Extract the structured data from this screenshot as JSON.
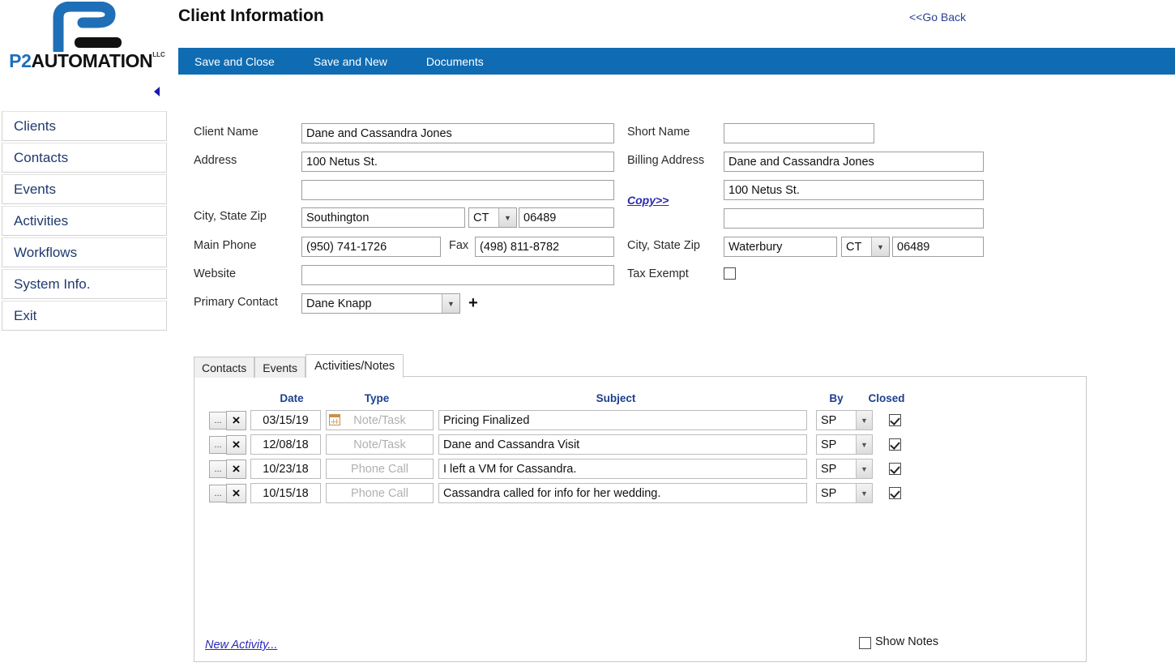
{
  "brand": {
    "logo_p2": "P2",
    "logo_automation": "AUTOMATION",
    "logo_tm": "LLC",
    "logo_icon": "p2-logo-mark",
    "collapse_icon": "collapse-left-arrow-icon"
  },
  "header": {
    "title": "Client Information",
    "go_back": "<<Go Back"
  },
  "toolbar": {
    "items": [
      {
        "label": "Save and Close",
        "name": "save-and-close"
      },
      {
        "label": "Save and New",
        "name": "save-and-new"
      },
      {
        "label": "Documents",
        "name": "documents"
      }
    ]
  },
  "sidebar": {
    "items": [
      {
        "label": "Clients"
      },
      {
        "label": "Contacts"
      },
      {
        "label": "Events"
      },
      {
        "label": "Activities"
      },
      {
        "label": "Workflows"
      },
      {
        "label": "System Info."
      },
      {
        "label": "Exit"
      }
    ]
  },
  "form": {
    "left": {
      "client_name_label": "Client Name",
      "client_name_value": "Dane and Cassandra Jones",
      "address_label": "Address",
      "address_line1": "100 Netus St.",
      "address_line2": "",
      "city_state_zip_label": "City, State Zip",
      "city": "Southington",
      "state": "CT",
      "zip": "06489",
      "main_phone_label": "Main Phone",
      "main_phone": "(950) 741-1726",
      "fax_label": "Fax",
      "fax": "(498) 811-8782",
      "website_label": "Website",
      "website": "",
      "primary_contact_label": "Primary Contact",
      "primary_contact": "Dane Knapp",
      "add_contact_icon": "plus-icon"
    },
    "right": {
      "short_name_label": "Short Name",
      "short_name_value": "",
      "billing_address_label": "Billing Address",
      "billing_line1": "Dane and Cassandra Jones",
      "billing_line2": "100 Netus St.",
      "billing_line3": "",
      "copy_link": "Copy>>",
      "city_state_zip_label": "City, State Zip",
      "city": "Waterbury",
      "state": "CT",
      "zip": "06489",
      "tax_exempt_label": "Tax Exempt",
      "tax_exempt_checked": false
    }
  },
  "tabs": [
    {
      "label": "Contacts",
      "active": false
    },
    {
      "label": "Events",
      "active": false
    },
    {
      "label": "Activities/Notes",
      "active": true
    }
  ],
  "grid": {
    "columns": [
      "Date",
      "Type",
      "Subject",
      "By",
      "Closed"
    ],
    "row_menu_label": "...",
    "row_delete_label": "×",
    "rows": [
      {
        "date": "03/15/19",
        "type": "Note/Task",
        "type_icon": "calendar-grid-icon",
        "subject": "Pricing Finalized",
        "by": "SP",
        "closed": true
      },
      {
        "date": "12/08/18",
        "type": "Note/Task",
        "type_icon": "",
        "subject": "Dane and Cassandra Visit",
        "by": "SP",
        "closed": true
      },
      {
        "date": "10/23/18",
        "type": "Phone Call",
        "type_icon": "",
        "subject": "I left a VM for Cassandra.",
        "by": "SP",
        "closed": true
      },
      {
        "date": "10/15/18",
        "type": "Phone Call",
        "type_icon": "",
        "subject": "Cassandra called for info for her wedding.",
        "by": "SP",
        "closed": true
      }
    ],
    "new_activity": "New Activity...",
    "show_notes_label": "Show Notes",
    "show_notes_checked": false
  },
  "colors": {
    "toolbar_blue": "#0f6cb3",
    "brand_blue": "#1f6fb8",
    "link_blue": "#2a2ab5",
    "sidebar_text": "#1f3a6e",
    "grid_header": "#1d3f8f"
  }
}
